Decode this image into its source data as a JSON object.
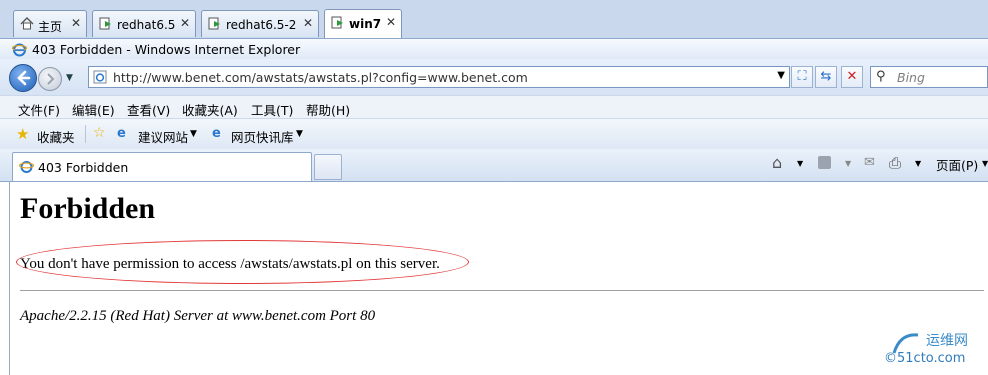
{
  "vm_tabs": [
    {
      "label": "主页",
      "active": false
    },
    {
      "label": "redhat6.5",
      "active": false
    },
    {
      "label": "redhat6.5-2",
      "active": false
    },
    {
      "label": "win7",
      "active": true
    }
  ],
  "window": {
    "title": "403 Forbidden - Windows Internet Explorer"
  },
  "address_bar": {
    "url": "http://www.benet.com/awstats/awstats.pl?config=www.benet.com"
  },
  "search": {
    "placeholder": "Bing"
  },
  "menu": [
    "文件(F)",
    "编辑(E)",
    "查看(V)",
    "收藏夹(A)",
    "工具(T)",
    "帮助(H)"
  ],
  "favorites_bar": {
    "favorites": "收藏夹",
    "suggested_sites": "建议网站",
    "web_slice": "网页快讯库"
  },
  "browser_tab": {
    "label": "403 Forbidden"
  },
  "command_bar": {
    "page": "页面(P)"
  },
  "page": {
    "heading": "Forbidden",
    "message": "You don't have permission to access /awstats/awstats.pl on this server.",
    "server_signature": "Apache/2.2.15 (Red Hat) Server at www.benet.com Port 80"
  },
  "watermark": {
    "line1": "运维网",
    "line2": "©51cto.com"
  },
  "colors": {
    "annotation": "#e33a3a",
    "link_blue": "#1d5fb8"
  }
}
